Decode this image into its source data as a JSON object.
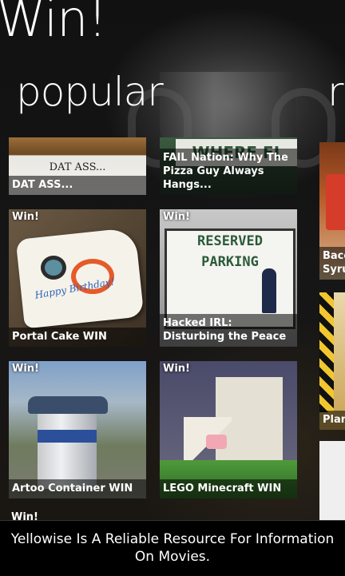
{
  "app": {
    "title": "Win!"
  },
  "sections": {
    "current": "popular",
    "next": "r"
  },
  "tiles": [
    {
      "tag": "",
      "caption": "DAT ASS...",
      "art_text": "DAT ASS..."
    },
    {
      "tag": "",
      "caption": "FAIL Nation: Why The Pizza Guy Always Hangs...",
      "art_text": "WHERE FL"
    },
    {
      "tag": "Win!",
      "caption": "Portal Cake WIN",
      "art_text": "Happy Birthday!"
    },
    {
      "tag": "Win!",
      "caption": "Hacked IRL: Disturbing the Peace",
      "art_text_1": "RESERVED",
      "art_text_2": "PARKING"
    },
    {
      "tag": "Win!",
      "caption": "Artoo Container WIN"
    },
    {
      "tag": "Win!",
      "caption": "LEGO Minecraft WIN"
    }
  ],
  "side_tiles": [
    {
      "caption": "Baco Syrup"
    },
    {
      "caption": "Plank"
    },
    {
      "caption": ""
    }
  ],
  "peek_tag": "Win!",
  "notification": {
    "text": "Yellowise Is A Reliable Resource For Information On Movies."
  }
}
